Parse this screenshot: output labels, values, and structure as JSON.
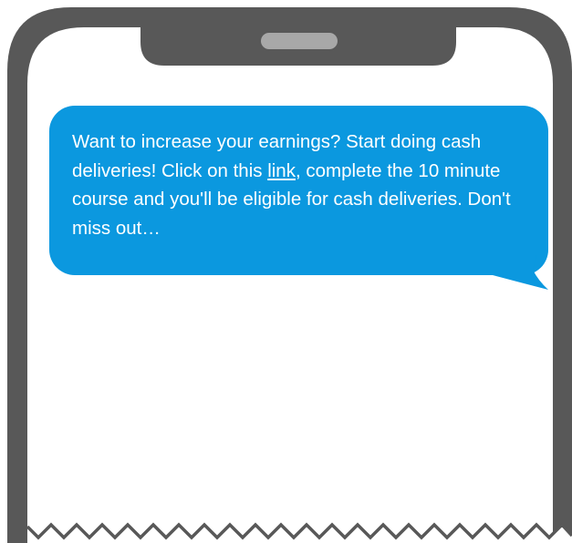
{
  "device": {
    "frame_color": "#585858",
    "signal_icon": "cellular-signal-icon",
    "wifi_icon": "wifi-icon"
  },
  "message": {
    "bubble_color": "#0b98df",
    "text_color": "#ffffff",
    "text_before_link": "Want to increase your earnings? Start doing cash deliveries! Click on this ",
    "link_text": "link",
    "text_after_link": ", complete the 10 minute course and you'll be eligible for cash deliveries. Don't miss out…"
  }
}
